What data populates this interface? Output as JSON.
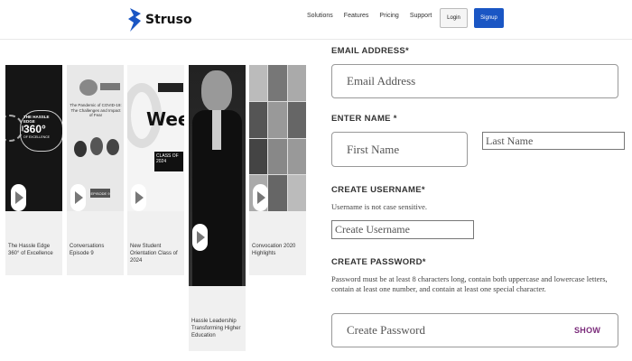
{
  "nav": {
    "logo_text": "Struso",
    "links": [
      "Solutions",
      "Features",
      "Pricing",
      "Support"
    ],
    "login_label": "Login",
    "signup_label": "Signup"
  },
  "cards": [
    {
      "caption": "The Hassle Edge 360° of Excellence",
      "thumb_text": "THE HASSLE EDGE 360°",
      "thumb_sub": "OF EXCELLENCE"
    },
    {
      "caption": "Conversations Episode 9",
      "thumb_text": "The Pandemic of COVID-19: The Challenges and Impact of Fear",
      "thumb_sub": "EPISODE 9"
    },
    {
      "caption": "New Student Orientation Class of 2024",
      "thumb_text": "Week",
      "thumb_sub": "CLASS OF 2024"
    },
    {
      "caption": "Hassle Leadership Transforming Higher Education",
      "thumb_text": "",
      "thumb_sub": ""
    },
    {
      "caption": "Convocation 2020 Highlights",
      "thumb_text": "",
      "thumb_sub": ""
    }
  ],
  "form": {
    "email_label": "EMAIL ADDRESS*",
    "email_placeholder": "Email Address",
    "name_label": "ENTER NAME *",
    "first_name_placeholder": "First Name",
    "last_name_placeholder": "Last Name",
    "username_label": "CREATE USERNAME*",
    "username_hint": "Username is not case sensitive.",
    "username_placeholder": "Create Username",
    "password_label": "CREATE PASSWORD*",
    "password_hint": "Password must be at least 8 characters long, contain both uppercase and lowercase letters, contain at least one number, and contain at least one special character.",
    "password_placeholder": "Create Password",
    "show_label": "SHOW"
  },
  "colors": {
    "brand_blue": "#1a56c4",
    "show_purple": "#7a2a7a"
  }
}
